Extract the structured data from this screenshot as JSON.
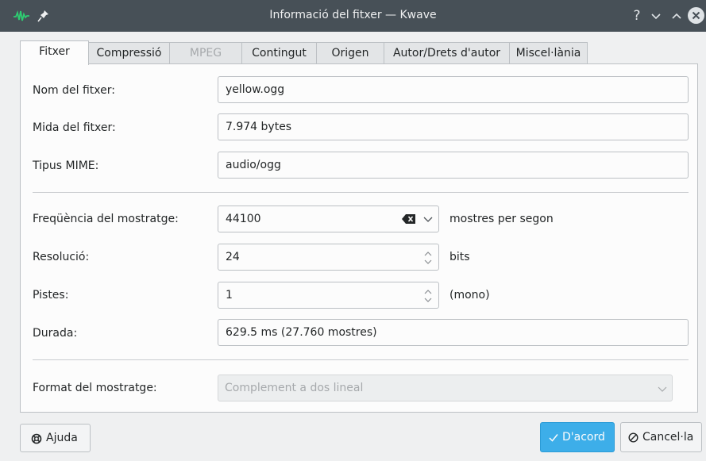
{
  "window": {
    "title": "Informació del fitxer — Kwave"
  },
  "titlebar": {
    "help_glyph": "?",
    "minimize_glyph": "⌄",
    "maximize_glyph": "⌃"
  },
  "tabs": [
    {
      "label": "Fitxer",
      "state": "active"
    },
    {
      "label": "Compressió",
      "state": "normal"
    },
    {
      "label": "MPEG",
      "state": "disabled"
    },
    {
      "label": "Contingut",
      "state": "normal"
    },
    {
      "label": "Origen",
      "state": "normal"
    },
    {
      "label": "Autor/Drets d'autor",
      "state": "normal"
    },
    {
      "label": "Miscel·lània",
      "state": "normal"
    }
  ],
  "fields": {
    "filename": {
      "label": "Nom del fitxer:",
      "value": "yellow.ogg"
    },
    "filesize": {
      "label": "Mida del fitxer:",
      "value": "7.974 bytes"
    },
    "mime": {
      "label": "Tipus MIME:",
      "value": "audio/ogg"
    },
    "samplerate": {
      "label": "Freqüència del mostratge:",
      "value": "44100",
      "suffix": "mostres per segon"
    },
    "resolution": {
      "label": "Resolució:",
      "value": "24",
      "suffix": "bits"
    },
    "tracks": {
      "label": "Pistes:",
      "value": "1",
      "suffix": "(mono)"
    },
    "duration": {
      "label": "Durada:",
      "value": "629.5 ms (27.760 mostres)"
    },
    "sampleformat": {
      "label": "Format del mostratge:",
      "value": "Complement a dos lineal"
    }
  },
  "buttons": {
    "help": "Ajuda",
    "ok": "D'acord",
    "cancel": "Cancel·la"
  },
  "colors": {
    "titlebar": "#475057",
    "accent": "#3daee9",
    "app_icon": "#2ecc71"
  },
  "icons": [
    "kwave-app-icon",
    "pin-icon",
    "help-icon",
    "minimize-icon",
    "maximize-icon",
    "close-icon",
    "clear-icon",
    "chevron-down-icon",
    "spinbox-arrows-icon",
    "lifebuoy-icon",
    "checkmark-icon",
    "cancel-icon"
  ]
}
